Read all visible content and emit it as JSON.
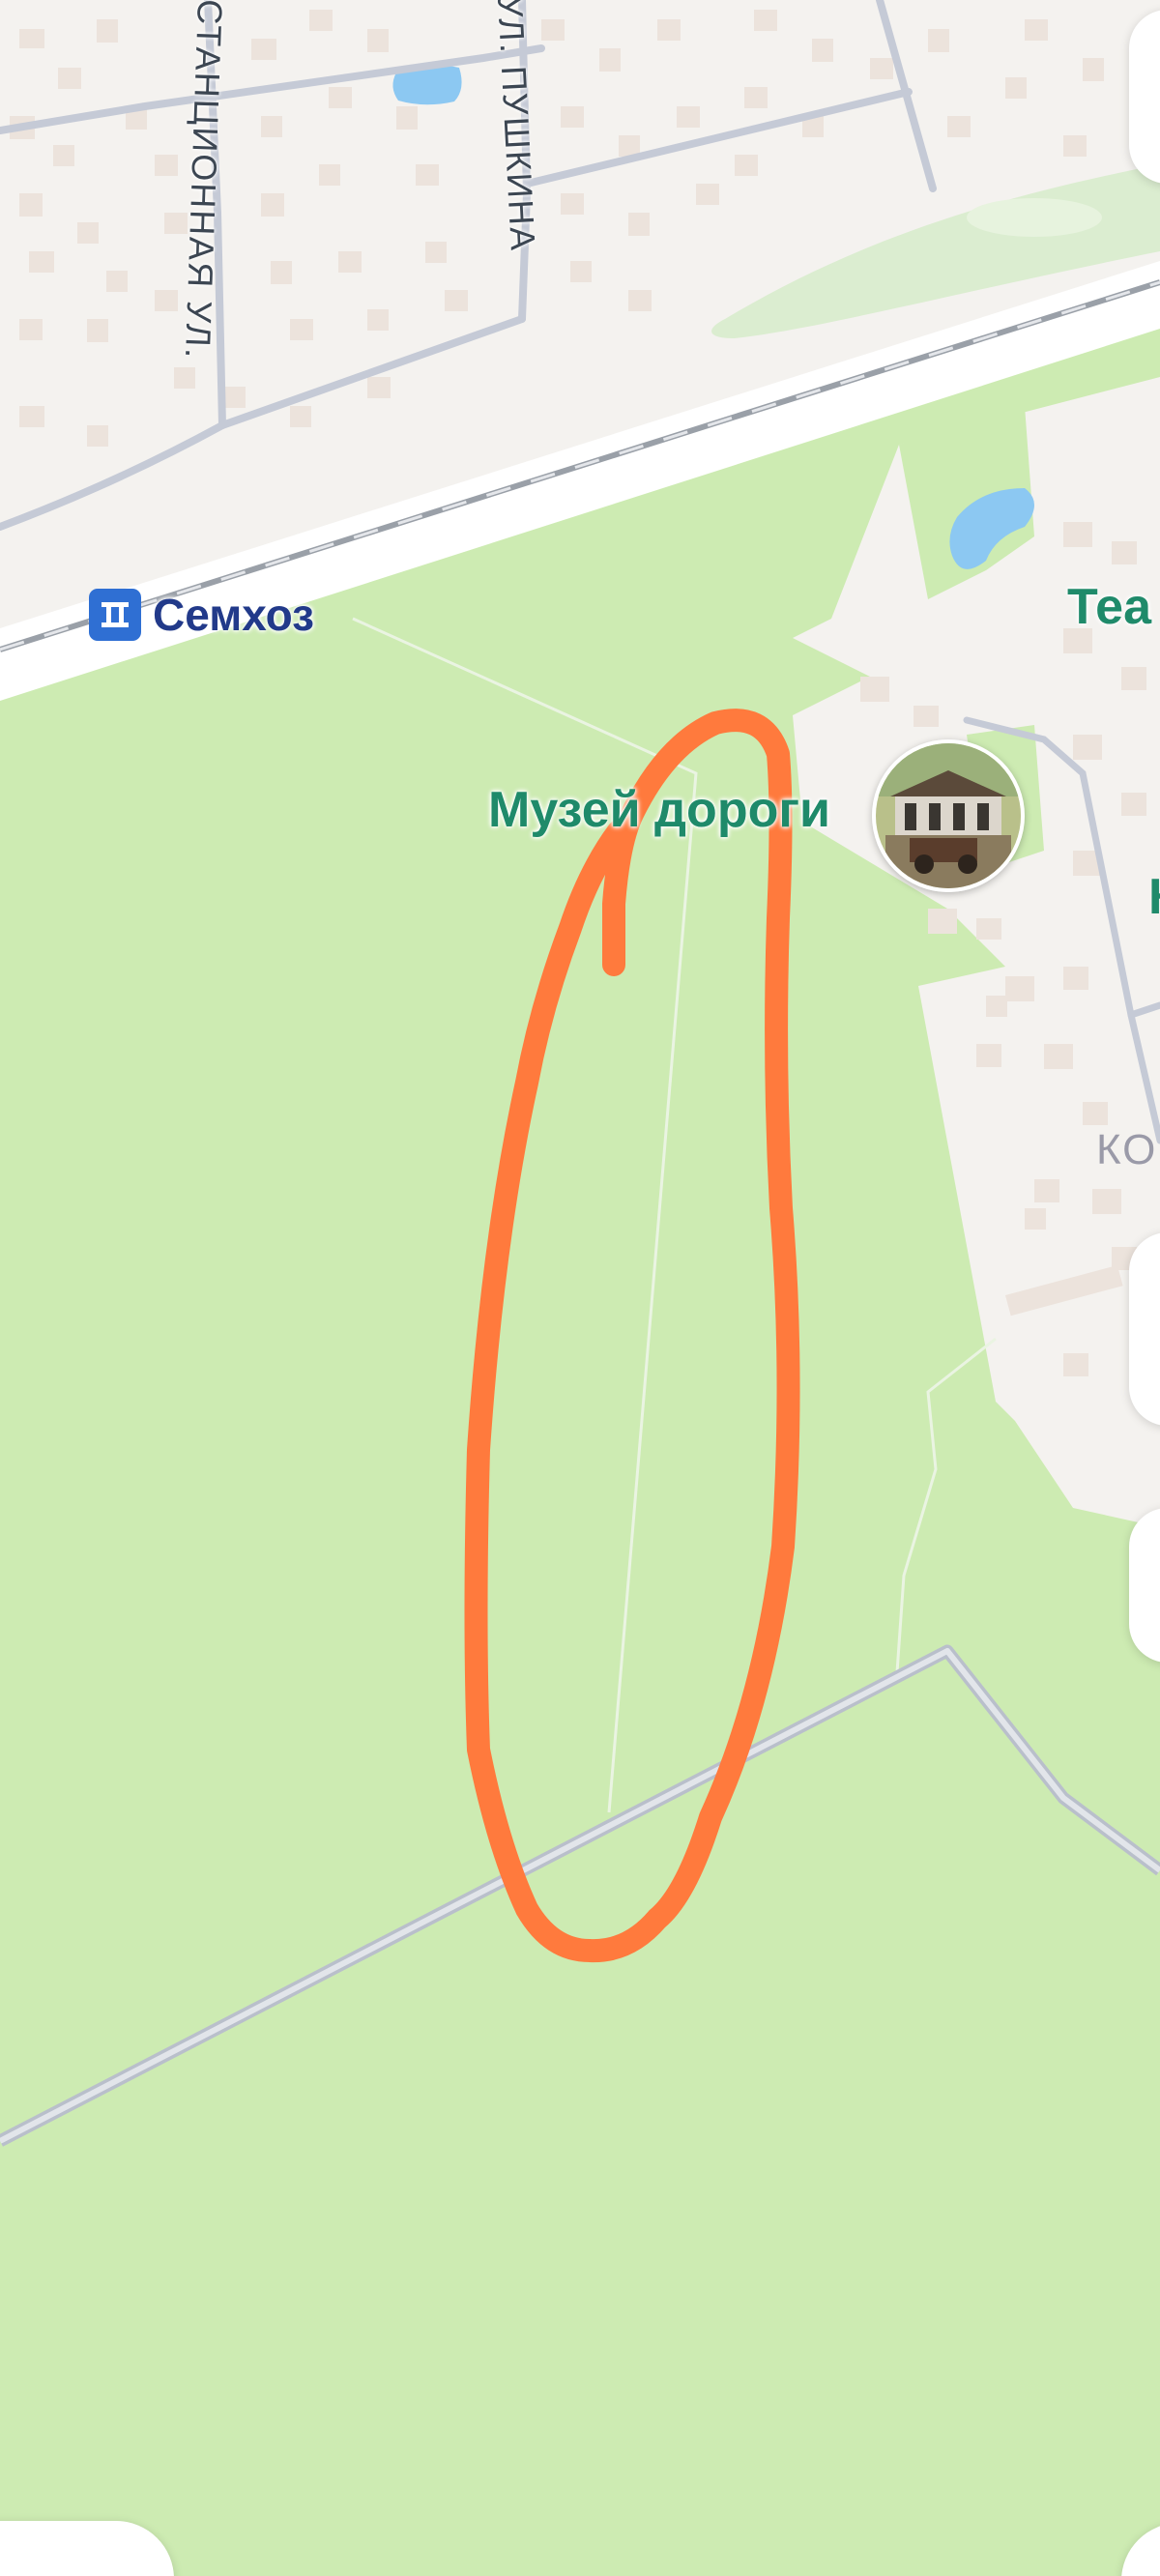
{
  "map": {
    "station": {
      "name": "Семхоз",
      "icon": "train-station-icon",
      "icon_color": "#2f6fd3",
      "text_color": "#223a8a"
    },
    "poi": {
      "name": "Музей дороги",
      "text_color": "#1f8a6a",
      "photo": "museum-photo-thumbnail"
    },
    "poi_partial": {
      "name": "Теа",
      "second": "К"
    },
    "streets": [
      {
        "name": "СТАНЦИОННАЯ УЛ."
      },
      {
        "name": "УЛ. ПУШКИНА"
      }
    ],
    "district_partial": "КО",
    "annotation": {
      "shape": "freehand-oval",
      "color": "#ff7a3d"
    },
    "colors": {
      "forest": "#cdebb2",
      "urban": "#f4f2ef",
      "road": "#c5cad6",
      "building": "#ece3dc",
      "water": "#8cc8f2",
      "poi_text": "#1f8a6a"
    }
  }
}
